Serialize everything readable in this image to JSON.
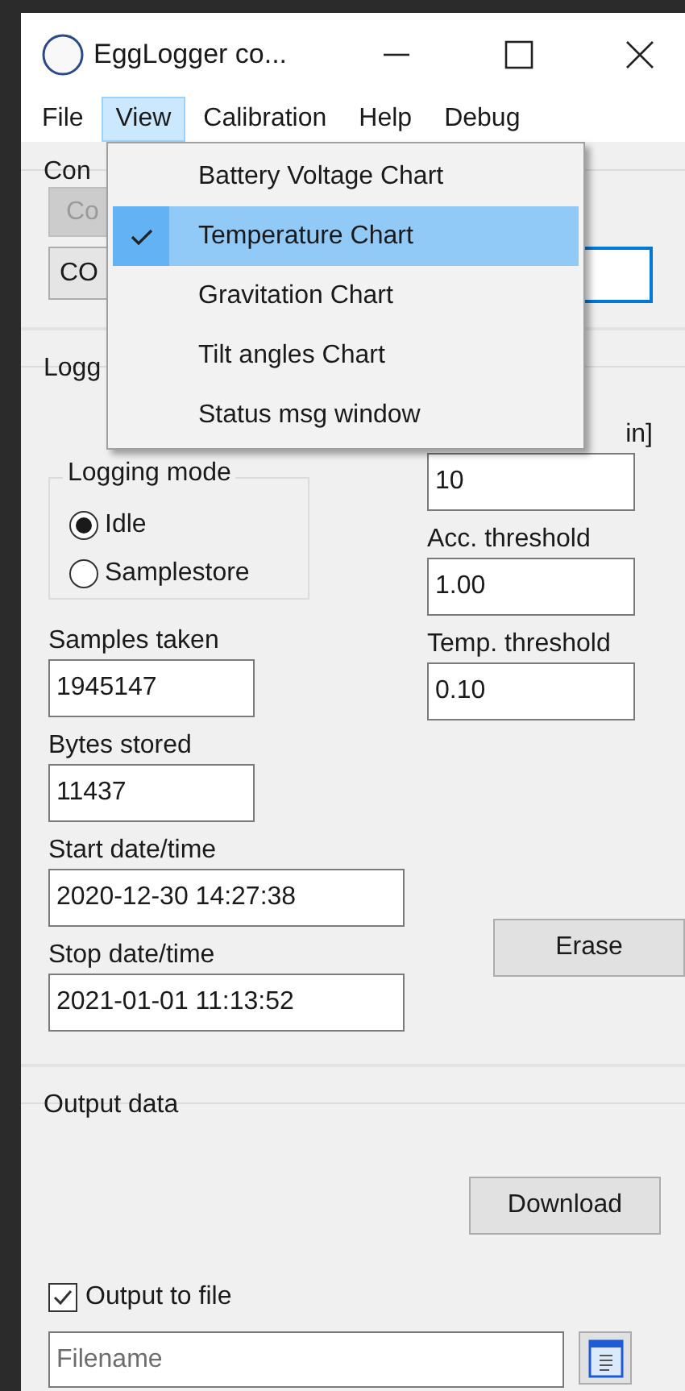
{
  "window": {
    "title": "EggLogger co..."
  },
  "menu_bar": [
    {
      "label": "File",
      "selected": false
    },
    {
      "label": "View",
      "selected": true
    },
    {
      "label": "Calibration",
      "selected": false
    },
    {
      "label": "Help",
      "selected": false
    },
    {
      "label": "Debug",
      "selected": false
    }
  ],
  "view_menu": [
    {
      "label": "Battery Voltage Chart",
      "checked": false,
      "selected": false
    },
    {
      "label": "Temperature Chart",
      "checked": true,
      "selected": true
    },
    {
      "label": "Gravitation Chart",
      "checked": false,
      "selected": false
    },
    {
      "label": "Tilt angles Chart",
      "checked": false,
      "selected": false
    },
    {
      "label": "Status msg window",
      "checked": false,
      "selected": false
    }
  ],
  "connection": {
    "title": "Con",
    "button": {
      "label": "Co",
      "disabled": true
    },
    "port_field": {
      "value": "CO"
    },
    "field_2": {
      "focused": true
    }
  },
  "logging": {
    "title": "Logg",
    "mode_group": {
      "title": "Logging mode",
      "options": [
        {
          "label": "Idle",
          "selected": true
        },
        {
          "label": "Samplestore",
          "selected": false
        }
      ]
    },
    "left_fields": [
      {
        "label": "Samples taken",
        "value": "1945147",
        "wide": false
      },
      {
        "label": "Bytes stored",
        "value": "11437",
        "wide": false
      },
      {
        "label": "Start date/time",
        "value": "2020-12-30 14:27:38",
        "wide": true
      },
      {
        "label": "Stop date/time",
        "value": "2021-01-01 11:13:52",
        "wide": true
      }
    ],
    "interval_field": {
      "label": "in]",
      "value": "10"
    },
    "right_fields": [
      {
        "label": "Acc. threshold",
        "value": "1.00"
      },
      {
        "label": "Temp. threshold",
        "value": "0.10"
      }
    ],
    "erase_button": "Erase"
  },
  "output": {
    "title": "Output data",
    "download_button": "Download",
    "output_to_file": {
      "label": "Output to file",
      "checked": true
    },
    "filename": {
      "placeholder": "Filename"
    }
  }
}
